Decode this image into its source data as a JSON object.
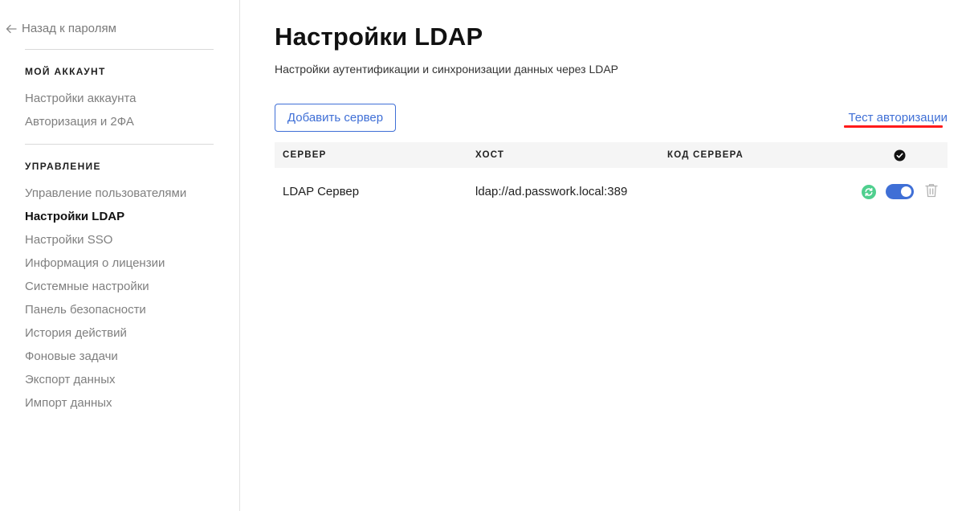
{
  "sidebar": {
    "back_label": "Назад к паролям",
    "sections": [
      {
        "title": "МОЙ АККАУНТ",
        "items": [
          "Настройки аккаунта",
          "Авторизация и 2ФА"
        ]
      },
      {
        "title": "УПРАВЛЕНИЕ",
        "items": [
          "Управление пользователями",
          "Настройки LDAP",
          "Настройки SSO",
          "Информация о лицензии",
          "Системные настройки",
          "Панель безопасности",
          "История действий",
          "Фоновые задачи",
          "Экспорт данных",
          "Импорт данных"
        ]
      }
    ],
    "active_item": "Настройки LDAP"
  },
  "main": {
    "title": "Настройки LDAP",
    "subtitle": "Настройки аутентификации и синхронизации данных через LDAP",
    "add_button": "Добавить сервер",
    "test_link": "Тест авторизации",
    "table": {
      "columns": [
        "СЕРВЕР",
        "ХОСТ",
        "КОД СЕРВЕРА"
      ],
      "status_column_icon": "check-circle-icon",
      "rows": [
        {
          "server": "LDAP Сервер",
          "host": "ldap://ad.passwork.local:389",
          "code": "",
          "enabled": true
        }
      ]
    }
  },
  "colors": {
    "accent": "#3f6fd6",
    "sync_green": "#4fcf8e",
    "highlight_red": "#ff1a1a"
  }
}
